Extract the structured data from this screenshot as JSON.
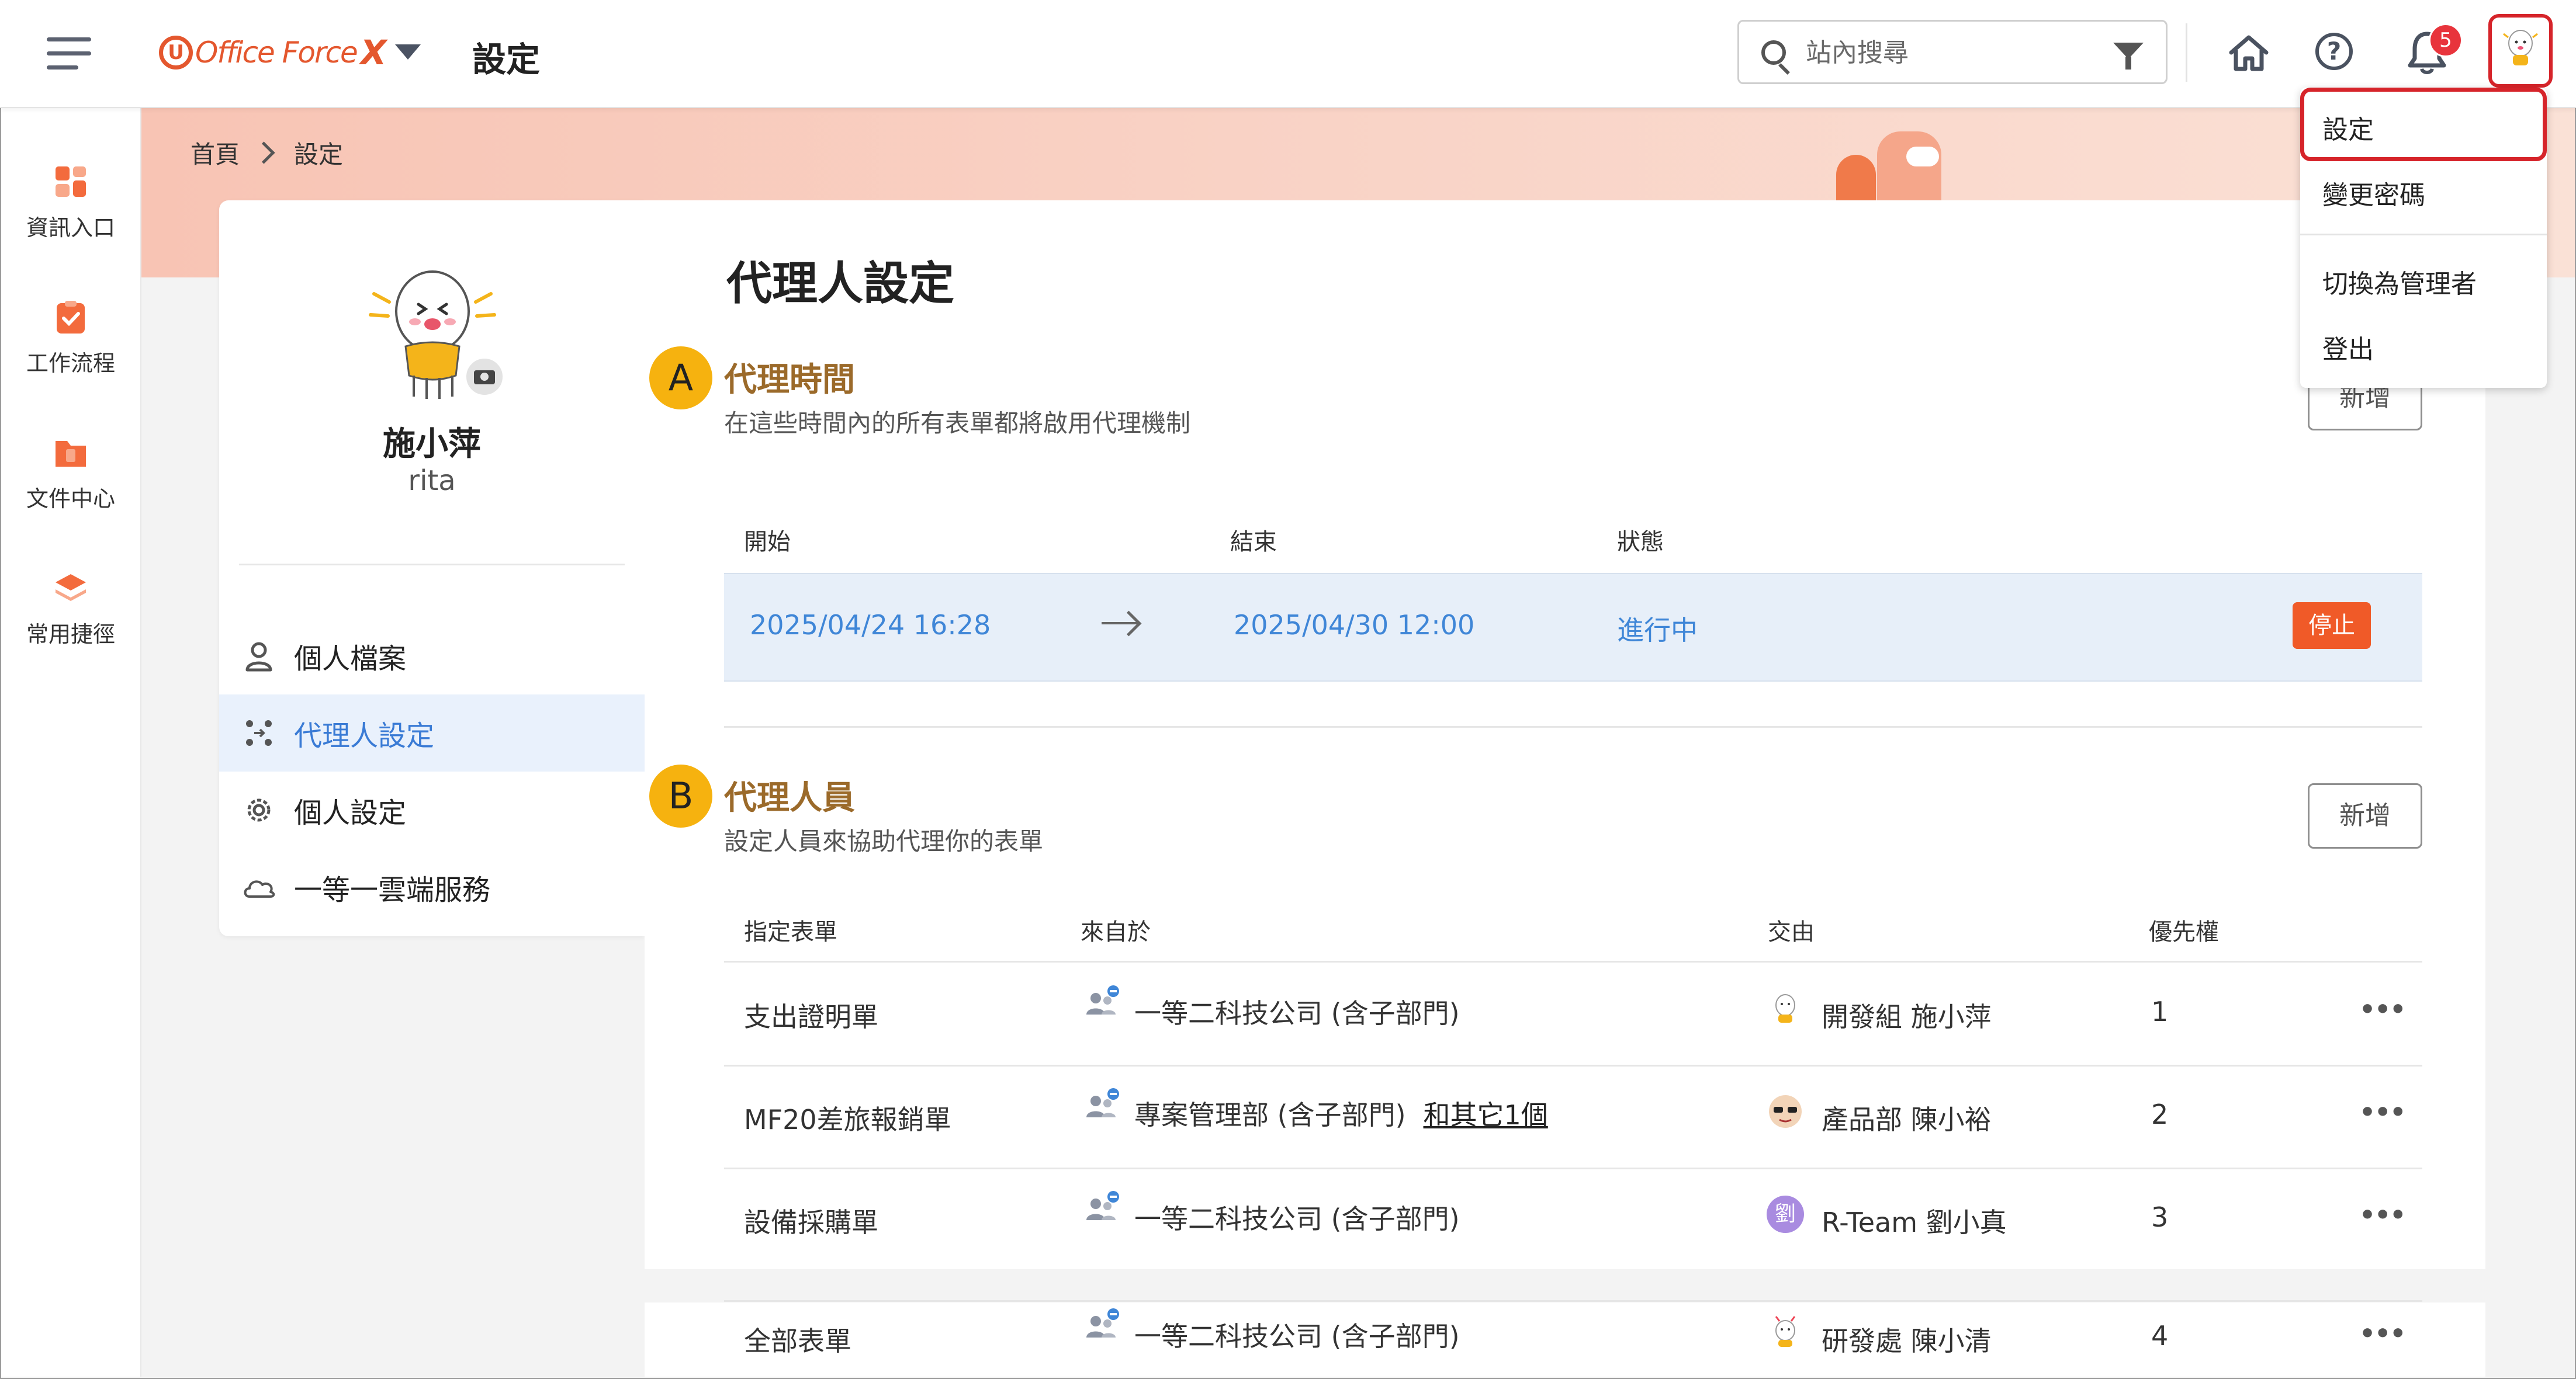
{
  "header": {
    "logo_text": "Office Force",
    "logo_x": "X",
    "page_title": "設定",
    "search_placeholder": "站內搜尋",
    "notification_count": "5"
  },
  "user_menu": {
    "items": [
      "設定",
      "變更密碼",
      "切換為管理者",
      "登出"
    ]
  },
  "rail": {
    "items": [
      {
        "label": "資訊入口",
        "icon": "portal-icon"
      },
      {
        "label": "工作流程",
        "icon": "workflow-icon"
      },
      {
        "label": "文件中心",
        "icon": "document-center-icon"
      },
      {
        "label": "常用捷徑",
        "icon": "shortcut-icon"
      }
    ]
  },
  "breadcrumb": {
    "home": "首頁",
    "current": "設定"
  },
  "profile": {
    "name": "施小萍",
    "username": "rita",
    "menu": [
      {
        "label": "個人檔案",
        "icon": "user-icon"
      },
      {
        "label": "代理人設定",
        "icon": "agent-icon"
      },
      {
        "label": "個人設定",
        "icon": "gear-icon"
      },
      {
        "label": "一等一雲端服務",
        "icon": "cloud-icon"
      }
    ]
  },
  "main": {
    "title": "代理人設定",
    "section_a": {
      "marker": "A",
      "title": "代理時間",
      "desc": "在這些時間內的所有表單都將啟用代理機制",
      "add_label": "新增",
      "headers": {
        "start": "開始",
        "end": "結束",
        "status": "狀態"
      },
      "row": {
        "start": "2025/04/24 16:28",
        "end": "2025/04/30 12:00",
        "status": "進行中",
        "stop_label": "停止"
      }
    },
    "section_b": {
      "marker": "B",
      "title": "代理人員",
      "desc": "設定人員來協助代理你的表單",
      "add_label": "新增",
      "headers": {
        "form": "指定表單",
        "from": "來自於",
        "to": "交由",
        "priority": "優先權"
      },
      "rows": [
        {
          "form": "支出證明單",
          "from": "一等二科技公司 (含子部門)",
          "extra": "",
          "to": "開發組 施小萍",
          "priority": "1"
        },
        {
          "form": "MF20差旅報銷單",
          "from": "專案管理部 (含子部門)",
          "extra": "和其它1個",
          "to": "產品部 陳小裕",
          "priority": "2"
        },
        {
          "form": "設備採購單",
          "from": "一等二科技公司 (含子部門)",
          "extra": "",
          "to": "R-Team 劉小真",
          "priority": "3"
        },
        {
          "form": "全部表單",
          "from": "一等二科技公司 (含子部門)",
          "extra": "",
          "to": "研發處 陳小清",
          "priority": "4"
        }
      ],
      "more_label": "•••"
    }
  },
  "avatar_initial": "劉",
  "colors": {
    "accent": "#3a7bd5",
    "brand": "#e4572e",
    "section_title": "#9b6a2a",
    "marker": "#f6b20f",
    "stop": "#f05a28",
    "highlight": "#d6242a"
  }
}
